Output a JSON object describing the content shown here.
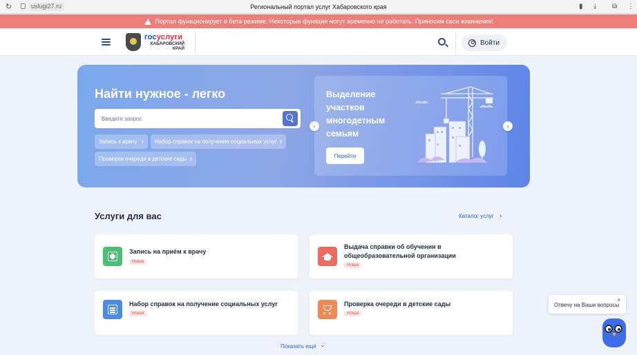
{
  "browser": {
    "url": "uslugi27.ru",
    "title": "Региональный портал услуг Хабаровского края"
  },
  "banner": {
    "text": "Портал функционирует в бета режиме. Некоторые функции могут временно не работать. Приносим свои извинения!"
  },
  "header": {
    "logo_gos": "гос",
    "logo_uslugi": "услуги",
    "logo_region": "ХАБАРОВСКИЙ КРАЙ",
    "login_label": "Войти"
  },
  "hero": {
    "title": "Найти нужное - легко",
    "search_placeholder": "Введите запрос",
    "chips": [
      "Запись к врачу",
      "Набор справок на получение социальных услуг",
      "Проверка очереди в детские сады"
    ],
    "promo_text": "Выделение участков многодетным семьям",
    "promo_button": "Перейти"
  },
  "services": {
    "title": "Услуги для вас",
    "catalog_link": "Каталог услуг",
    "cards": [
      {
        "title": "Запись на приём к врачу",
        "badge": "Новая",
        "icon": "medical-kit-icon",
        "color": "#4bbf73"
      },
      {
        "title": "Выдача справки об обучении в общеобразовательной организации",
        "badge": "Новая",
        "icon": "graduation-cap-icon",
        "color": "#ea6b62"
      },
      {
        "title": "Набор справок на получение социальных услуг",
        "badge": "Новая",
        "icon": "document-list-icon",
        "color": "#4a8be6"
      },
      {
        "title": "Проверка очереди в детские сады",
        "badge": "Новая",
        "icon": "stroller-icon",
        "color": "#ef8a57"
      }
    ],
    "show_more": "Показать ещё"
  },
  "chat": {
    "bubble_text": "Отвечу на Ваши вопросы"
  },
  "colors": {
    "banner_bg": "#ee7f78",
    "accent": "#2f5fd0",
    "page_bg": "#eef3fb"
  }
}
